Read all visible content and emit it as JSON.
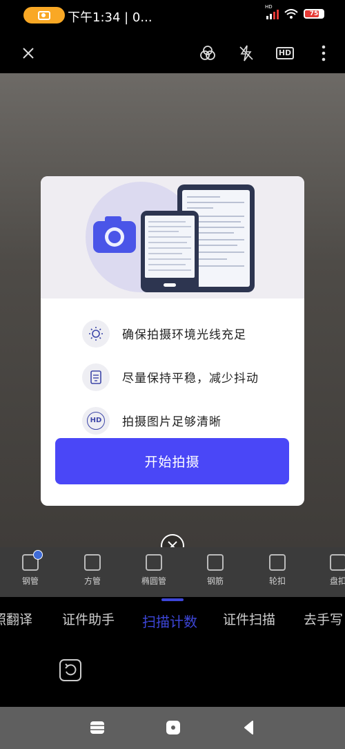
{
  "status_bar": {
    "time": "下午1:34 | 0...",
    "signal_label": "HD",
    "battery": "75",
    "battery_level": 0.75
  },
  "top_bar": {
    "close_icon": "close-icon",
    "filter_icon": "filter-icon",
    "flash_icon": "flash-off-icon",
    "hd_label": "HD",
    "more_icon": "more-vertical-icon"
  },
  "dialog": {
    "tips": [
      {
        "icon": "brightness-icon",
        "text": "确保拍摄环境光线充足"
      },
      {
        "icon": "document-icon",
        "text": "尽量保持平稳，减少抖动"
      },
      {
        "icon": "hd-icon",
        "text": "拍摄图片足够清晰",
        "icon_label": "HD"
      }
    ],
    "start_button": "开始拍摄"
  },
  "tools": [
    {
      "label": "钢管",
      "selected": true
    },
    {
      "label": "方管",
      "selected": false
    },
    {
      "label": "椭圆管",
      "selected": false
    },
    {
      "label": "钢筋",
      "selected": false
    },
    {
      "label": "轮扣",
      "selected": false
    },
    {
      "label": "盘扣",
      "selected": false
    }
  ],
  "modes": [
    {
      "label": "照翻译",
      "active": false
    },
    {
      "label": "证件助手",
      "active": false
    },
    {
      "label": "扫描计数",
      "active": true
    },
    {
      "label": "证件扫描",
      "active": false
    },
    {
      "label": "去手写",
      "active": false
    }
  ],
  "colors": {
    "accent": "#4a47f7",
    "active_mode": "#3d46d8",
    "status_pill": "#f9a825"
  }
}
